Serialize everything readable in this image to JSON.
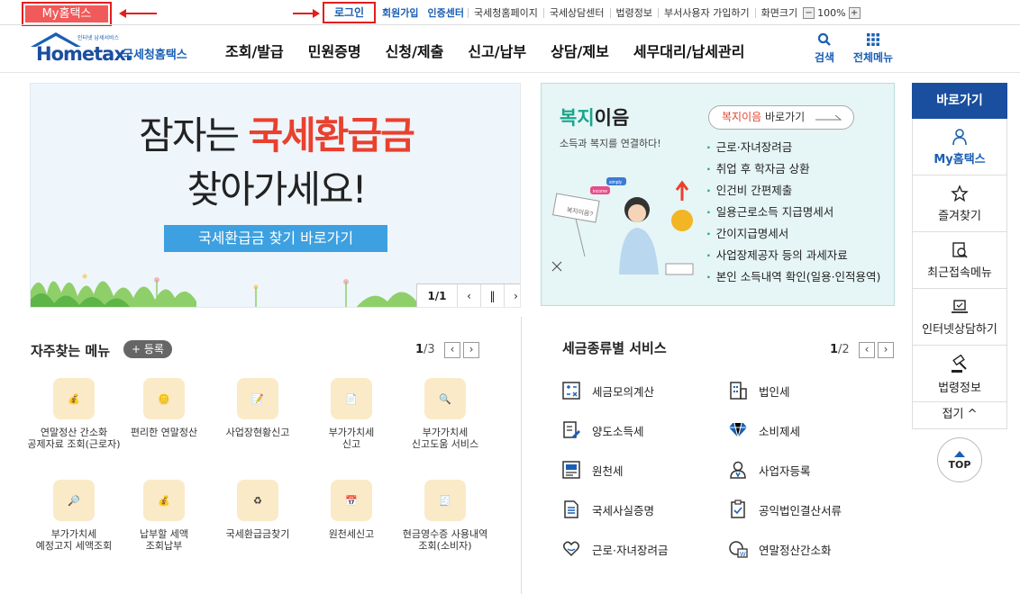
{
  "topbar": {
    "my_hometax": "My홈택스",
    "login": "로그인",
    "signup": "회원가입",
    "auth_center": "인증센터",
    "links": [
      "국세청홈페이지",
      "국세상담센터",
      "법령정보",
      "부서사용자 가입하기"
    ],
    "screen_size": "화면크기",
    "zoom_minus": "−",
    "zoom_value": "100%",
    "zoom_plus": "+"
  },
  "header": {
    "logo_small": "인터넷 납세서비스",
    "logo_main": "Hometax.",
    "logo_org": "국세청홈택스",
    "gnb": [
      "조회/발급",
      "민원증명",
      "신청/제출",
      "신고/납부",
      "상담/제보",
      "세무대리/납세관리"
    ],
    "search": "검색",
    "all_menu": "전체메뉴"
  },
  "banner": {
    "line1_a": "잠자는 ",
    "line1_b": "국세환급금",
    "line2": "찾아가세요!",
    "button": "국세환급금 찾기 바로가기",
    "page": "1/1",
    "prev": "‹",
    "pause": "‖",
    "next": "›"
  },
  "welfare": {
    "title_a": "복지",
    "title_b": "이음",
    "subtitle": "소득과 복지를 연결하다!",
    "link_a": "복지이음",
    "link_b": " 바로가기",
    "items": [
      "근로·자녀장려금",
      "취업 후 학자금 상환",
      "인건비 간편제출",
      "일용근로소득 지급명세서",
      "간이지급명세서",
      "사업장제공자 등의 과세자료",
      "본인 소득내역 확인(일용·인적용역)"
    ],
    "illus_sign": "복지이음?",
    "illus_tag1": "simply",
    "illus_tag2": "income"
  },
  "quick": {
    "title": "바로가기",
    "items": [
      "My홈택스",
      "즐겨찾기",
      "최근접속메뉴",
      "인터넷상담하기",
      "법령정보"
    ],
    "fold": "접기 ^",
    "top": "TOP"
  },
  "favorites": {
    "title": "자주찾는 메뉴",
    "register": "+ 등록",
    "page_cur": "1",
    "page_total": "/3",
    "items": [
      "연말정산 간소화\n공제자료 조회(근로자)",
      "편리한 연말정산",
      "사업장현황신고",
      "부가가치세\n신고",
      "부가가치세\n신고도움 서비스",
      "부가가치세\n예정고지 세액조회",
      "납부할 세액\n조회납부",
      "국세환급금찾기",
      "원천세신고",
      "현금영수증 사용내역조회(소비자)"
    ]
  },
  "taxservices": {
    "title": "세금종류별 서비스",
    "page_cur": "1",
    "page_total": "/2",
    "left": [
      "세금모의계산",
      "양도소득세",
      "원천세",
      "국세사실증명",
      "근로·자녀장려금"
    ],
    "right": [
      "법인세",
      "소비제세",
      "사업자등록",
      "공익법인결산서류",
      "연말정산간소화"
    ]
  },
  "colors": {
    "accent": "#1a5fb4",
    "alert": "#e31d1d",
    "welfare": "#1aa58c"
  }
}
